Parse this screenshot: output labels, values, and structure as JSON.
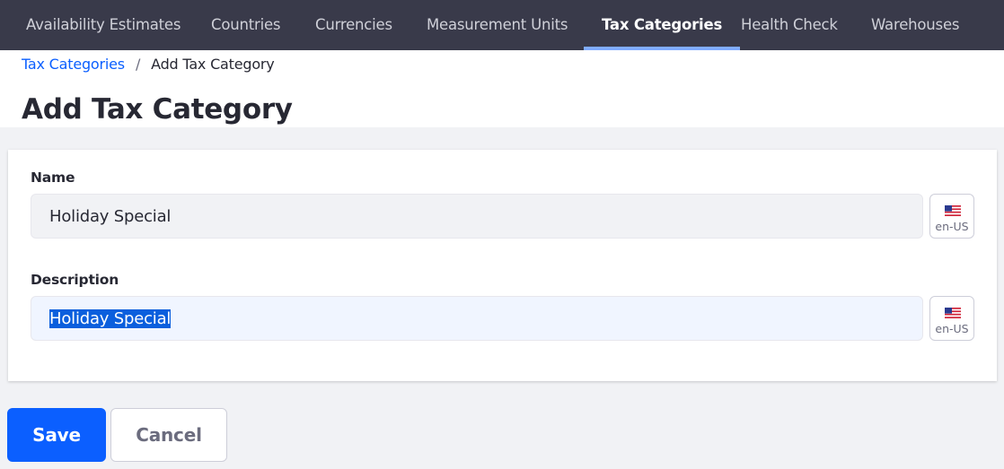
{
  "nav": {
    "tabs": [
      {
        "label": "Availability Estimates",
        "active": false
      },
      {
        "label": "Countries",
        "active": false
      },
      {
        "label": "Currencies",
        "active": false
      },
      {
        "label": "Measurement Units",
        "active": false
      },
      {
        "label": "Tax Categories",
        "active": true
      },
      {
        "label": "Health Check",
        "active": false
      },
      {
        "label": "Warehouses",
        "active": false
      }
    ],
    "active_indicator_color": "#80acff"
  },
  "breadcrumb": {
    "parent": "Tax Categories",
    "separator": "/",
    "current": "Add Tax Category"
  },
  "page": {
    "title": "Add Tax Category"
  },
  "form": {
    "name": {
      "label": "Name",
      "value": "Holiday Special",
      "locale": "en-US",
      "flag_icon": "us-flag-icon"
    },
    "description": {
      "label": "Description",
      "value": "Holiday Special",
      "selected": true,
      "locale": "en-US",
      "flag_icon": "us-flag-icon"
    }
  },
  "actions": {
    "save_label": "Save",
    "cancel_label": "Cancel",
    "primary_color": "#0b5fff"
  }
}
